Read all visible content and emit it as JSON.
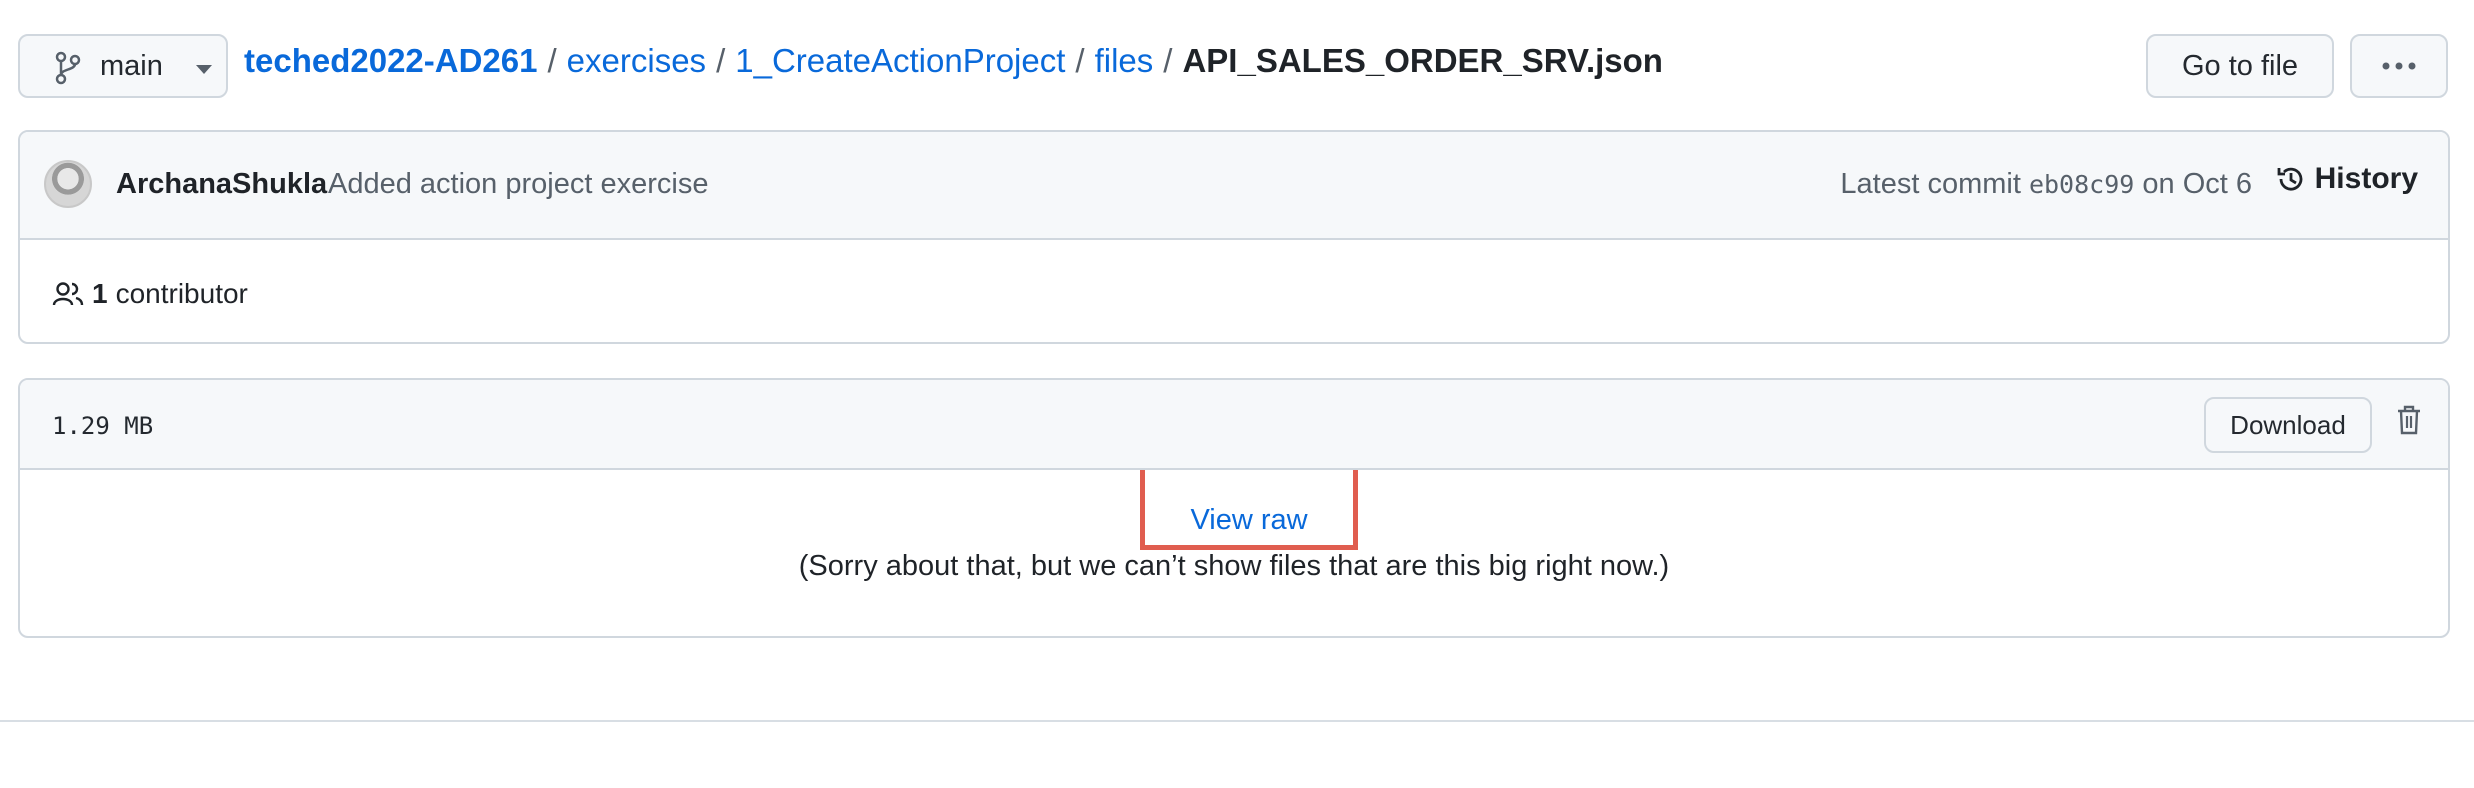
{
  "branch": {
    "label": "main",
    "icon": "git-branch-icon"
  },
  "breadcrumb": {
    "repo": "teched2022-AD261",
    "segments": [
      "exercises",
      "1_CreateActionProject",
      "files"
    ],
    "separator": "/",
    "filename": "API_SALES_ORDER_SRV.json"
  },
  "toolbar": {
    "go_to_file": "Go to file",
    "more_icon": "kebab-horizontal-icon"
  },
  "commit": {
    "author": "ArchanaShukla",
    "message": "Added action project exercise",
    "latest_prefix": "Latest commit",
    "sha": "eb08c99",
    "date_text": "on Oct 6",
    "history_label": "History",
    "history_icon": "history-icon"
  },
  "contributors": {
    "count": "1",
    "label": "contributor",
    "icon": "people-icon"
  },
  "file": {
    "size": "1.29 MB",
    "download_label": "Download",
    "delete_icon": "trash-icon",
    "view_raw": "View raw",
    "too_big_message": "(Sorry about that, but we can’t show files that are this big right now.)"
  },
  "colors": {
    "link": "#0969da",
    "highlight_box": "#e05d4f",
    "border": "#d0d7de",
    "header_bg": "#f6f8fa"
  }
}
